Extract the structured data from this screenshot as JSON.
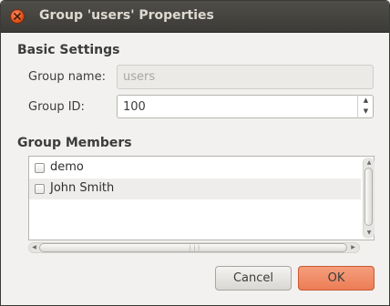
{
  "window": {
    "title": "Group 'users' Properties",
    "close_icon": "close-icon"
  },
  "basic_settings": {
    "heading": "Basic Settings",
    "group_name_label": "Group name:",
    "group_name_value": "users",
    "group_id_label": "Group ID:",
    "group_id_value": "100"
  },
  "members": {
    "heading": "Group Members",
    "items": [
      {
        "label": "demo",
        "checked": false
      },
      {
        "label": "John Smith",
        "checked": false
      }
    ]
  },
  "buttons": {
    "cancel": "Cancel",
    "ok": "OK"
  },
  "colors": {
    "titlebar": "#3c3b37",
    "close_button": "#e0531b",
    "ok_button": "#ec7d55"
  }
}
